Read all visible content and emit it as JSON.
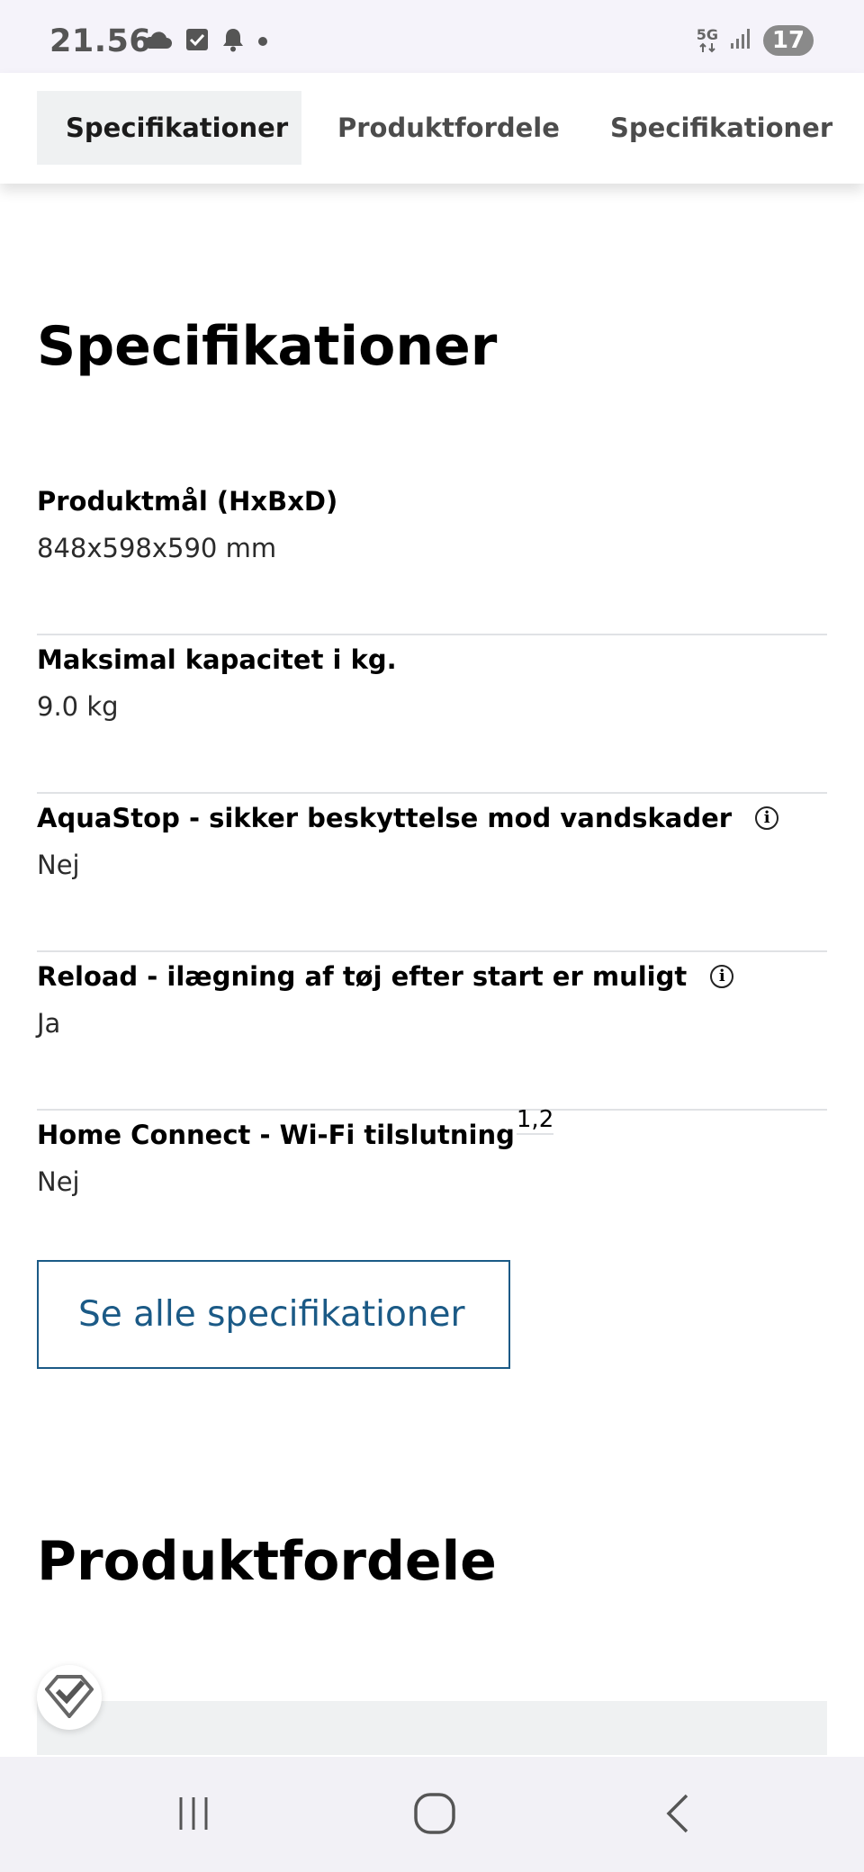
{
  "status_bar": {
    "time": "21.56",
    "network_label": "5G",
    "battery_level": "17",
    "icons": [
      "cloud-icon",
      "checkbox-icon",
      "bell-icon",
      "dot-icon",
      "network-5g-icon",
      "signal-icon",
      "battery-icon"
    ]
  },
  "tabs": [
    {
      "label": "Specifikationer",
      "active": true
    },
    {
      "label": "Produktfordele",
      "active": false
    },
    {
      "label": "Specifikationer",
      "active": false
    }
  ],
  "specs_section": {
    "title": "Specifikationer",
    "items": [
      {
        "label": "Produktmål (HxBxD)",
        "value": "848x598x590 mm"
      },
      {
        "label": "Maksimal kapacitet i kg.",
        "value": "9.0 kg"
      },
      {
        "label": "AquaStop - sikker beskyttelse mod vandskader",
        "value": "Nej"
      },
      {
        "label": "Reload - ilægning af tøj efter start er muligt",
        "value": "Ja"
      },
      {
        "label": "Home Connect - Wi-Fi tilslutning",
        "footnotes": "1,2",
        "value": "Nej"
      }
    ],
    "see_all_label": "Se alle specifikationer"
  },
  "benefits_section": {
    "title": "Produktfordele"
  },
  "colors": {
    "accent": "#1b5a86",
    "tab_active_bg": "#eff1f2",
    "divider": "#e0e2e5"
  }
}
